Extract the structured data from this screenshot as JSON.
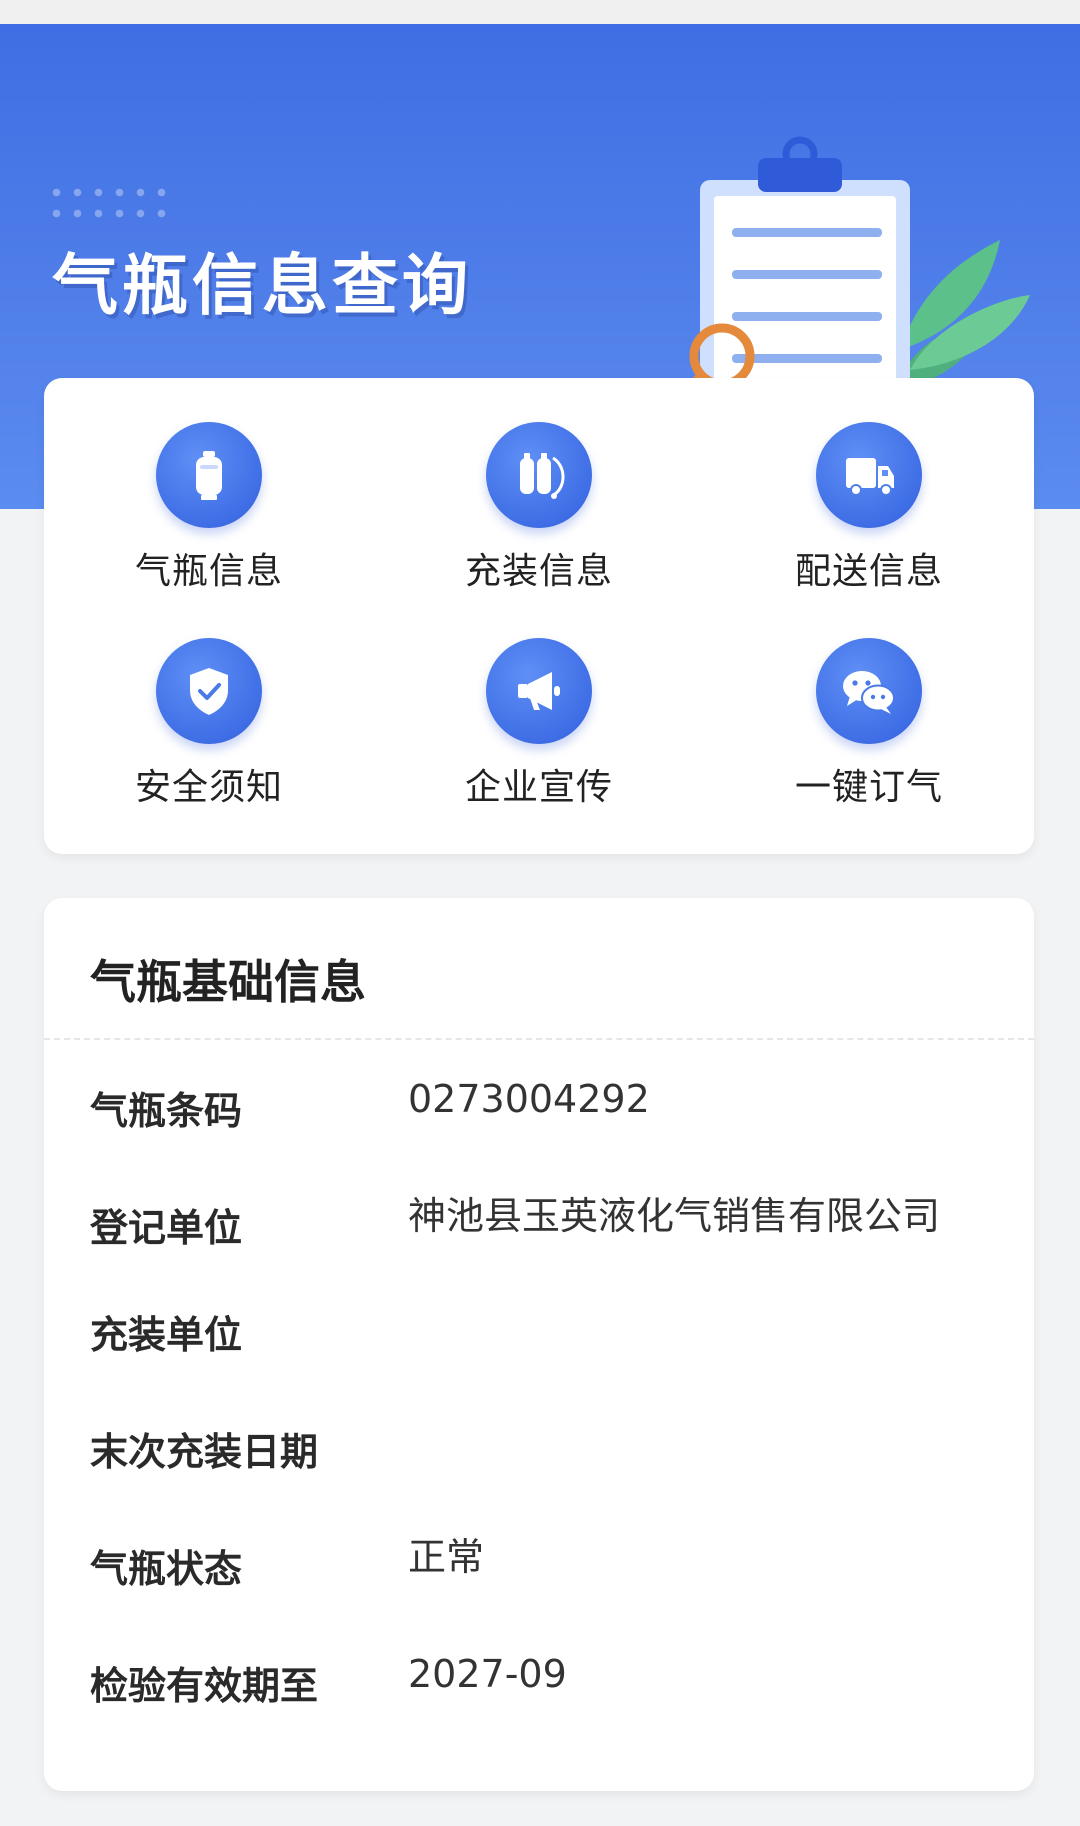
{
  "banner": {
    "title": "气瓶信息查询"
  },
  "menu": {
    "items": [
      {
        "label": "气瓶信息",
        "icon": "gas-cylinder-icon"
      },
      {
        "label": "充装信息",
        "icon": "cylinder-filling-icon"
      },
      {
        "label": "配送信息",
        "icon": "delivery-truck-icon"
      },
      {
        "label": "安全须知",
        "icon": "shield-check-icon"
      },
      {
        "label": "企业宣传",
        "icon": "megaphone-icon"
      },
      {
        "label": "一键订气",
        "icon": "wechat-icon"
      }
    ]
  },
  "info": {
    "title": "气瓶基础信息",
    "rows": [
      {
        "label": "气瓶条码",
        "value": "0273004292"
      },
      {
        "label": "登记单位",
        "value": "神池县玉英液化气销售有限公司"
      },
      {
        "label": "充装单位",
        "value": ""
      },
      {
        "label": "末次充装日期",
        "value": ""
      },
      {
        "label": "气瓶状态",
        "value": "正常"
      },
      {
        "label": "检验有效期至",
        "value": "2027-09"
      }
    ]
  },
  "colors": {
    "banner_blue": "#4573e6",
    "icon_blue": "#3f6ee6",
    "page_bg": "#f2f3f5"
  }
}
